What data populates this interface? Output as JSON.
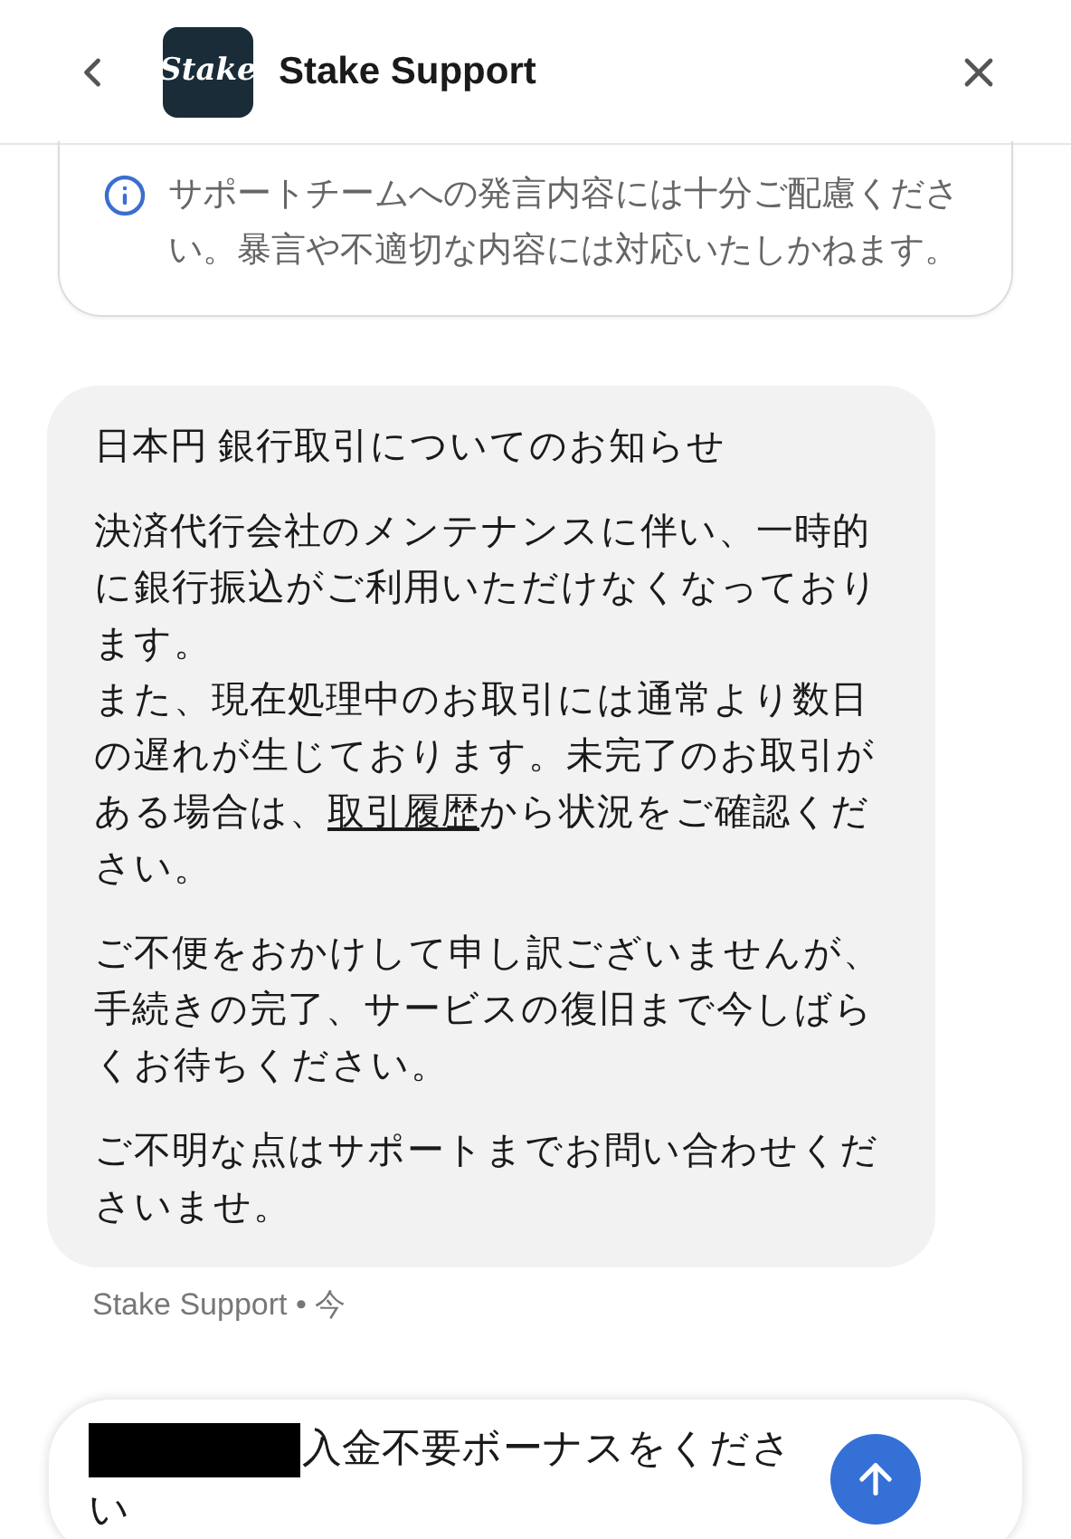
{
  "header": {
    "title": "Stake Support",
    "logo": "Stake"
  },
  "notice": {
    "text": "サポートチームへの発言内容には十分ご配慮ください。暴言や不適切な内容には対応いたしかねます。"
  },
  "message": {
    "paragraphs": [
      {
        "lines": [
          [
            {
              "kind": "text",
              "text": "日本円 銀行取引についてのお知らせ"
            }
          ]
        ]
      },
      {
        "lines": [
          [
            {
              "kind": "text",
              "text": "決済代行会社のメンテナンスに伴い、一時的に銀行振込がご利用いただけなくなっております。"
            }
          ],
          [
            {
              "kind": "text",
              "text": "また、現在処理中のお取引には通常より数日の遅れが生じております。未完了のお取引がある場合は、"
            },
            {
              "kind": "link",
              "text": "取引履歴"
            },
            {
              "kind": "text",
              "text": "から状況をご確認ください。"
            }
          ]
        ]
      },
      {
        "lines": [
          [
            {
              "kind": "text",
              "text": "ご不便をおかけして申し訳ございませんが、手続きの完了、サービスの復旧まで今しばらくお待ちください。"
            }
          ]
        ]
      },
      {
        "lines": [
          [
            {
              "kind": "text",
              "text": "ご不明な点はサポートまでお問い合わせくださいませ。"
            }
          ]
        ]
      }
    ],
    "meta": "Stake Support • 今"
  },
  "composer": {
    "redacted": true,
    "value": "入金不要ボーナスをください"
  }
}
